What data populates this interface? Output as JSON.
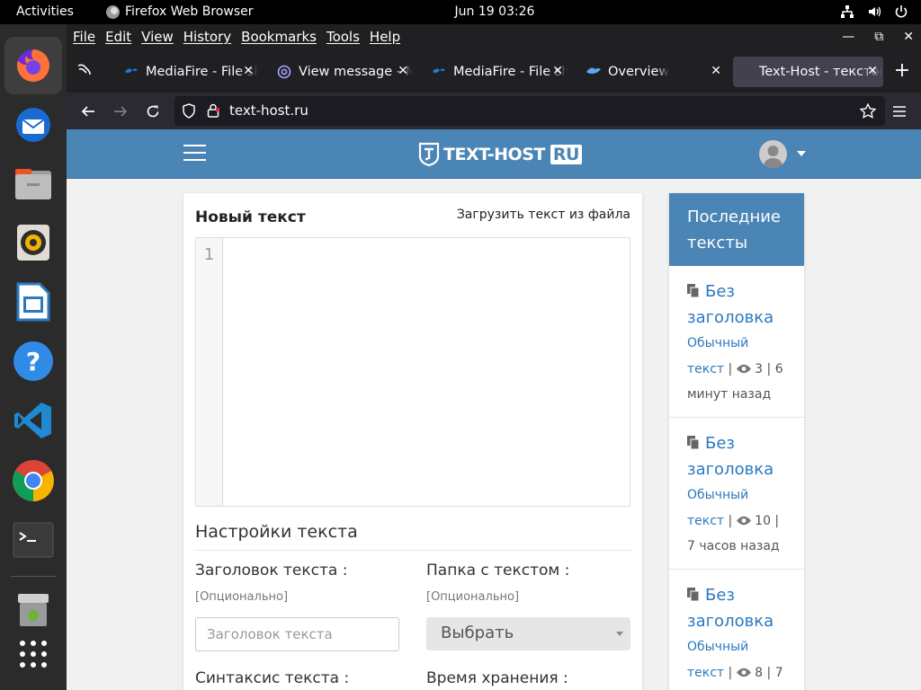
{
  "system": {
    "activities": "Activities",
    "app_name": "Firefox Web Browser",
    "clock": "Jun 19  03:26"
  },
  "menubar": {
    "items": [
      "File",
      "Edit",
      "View",
      "History",
      "Bookmarks",
      "Tools",
      "Help"
    ]
  },
  "tabs": [
    {
      "label": "MediaFire - File sharing",
      "icon": "mediafire-icon"
    },
    {
      "label": "View message - Mail",
      "icon": "at-sign-icon"
    },
    {
      "label": "MediaFire - File sharing",
      "icon": "mediafire-icon"
    },
    {
      "label": "Overview",
      "icon": "overview-icon"
    },
    {
      "label": "Text-Host - текстовый хостинг",
      "icon": "",
      "selected": true
    }
  ],
  "navbar": {
    "url": "text-host.ru"
  },
  "site": {
    "logo_text": "TEXT-HOST",
    "logo_ru": "RU",
    "accent": "#4a85b5",
    "link": "#2a79c0"
  },
  "editor": {
    "heading": "Новый текст",
    "upload_link": "Загрузить текст из файла",
    "line_number": "1",
    "settings_heading": "Настройки текста",
    "title_label": "Заголовок текста :",
    "title_hint": "[Опционально]",
    "title_placeholder": "Заголовок текста",
    "folder_label": "Папка с текстом :",
    "folder_hint": "[Опционально]",
    "folder_select": "Выбрать",
    "syntax_label": "Синтаксис текста :",
    "expiry_label": "Время хранения :"
  },
  "sidebar": {
    "heading": "Последние тексты",
    "items": [
      {
        "title": "Без заголовка",
        "type": "Обычный текст",
        "views": "3",
        "time": "6 минут назад"
      },
      {
        "title": "Без заголовка",
        "type": "Обычный текст",
        "views": "10",
        "time": "7 часов назад"
      },
      {
        "title": "Без заголовка",
        "type": "Обычный текст",
        "views": "8",
        "time": "7"
      }
    ]
  }
}
